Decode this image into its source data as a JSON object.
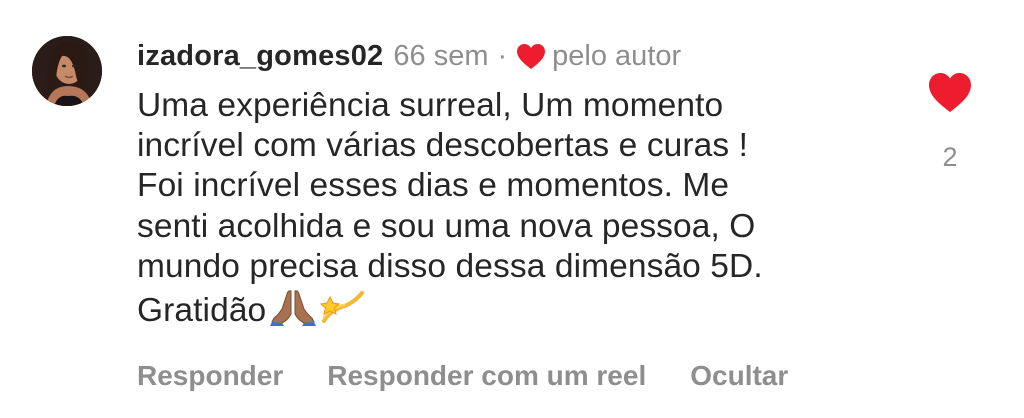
{
  "comment": {
    "username": "izadora_gomes02",
    "timestamp": "66 sem",
    "separator": "·",
    "liked_by_author_icon": "heart-icon",
    "liked_by_author_text": "pelo autor",
    "body_lines": [
      "Uma experiência surreal, Um momento",
      "incrível com várias descobertas e curas !",
      "Foi incrível esses dias e momentos. Me",
      "senti acolhida e sou uma nova pessoa, O",
      "mundo precisa disso dessa dimensão 5D.",
      "Gratidão"
    ],
    "emojis": [
      "praying-hands-emoji",
      "dizzy-emoji"
    ],
    "like_icon": "heart-icon",
    "like_count": "2"
  },
  "actions": {
    "reply": "Responder",
    "reply_reel": "Responder com um reel",
    "hide": "Ocultar"
  },
  "colors": {
    "heart": "#ed1c2e",
    "primary_text": "#262626",
    "secondary_text": "#8e8e8e",
    "background": "#ffffff"
  }
}
